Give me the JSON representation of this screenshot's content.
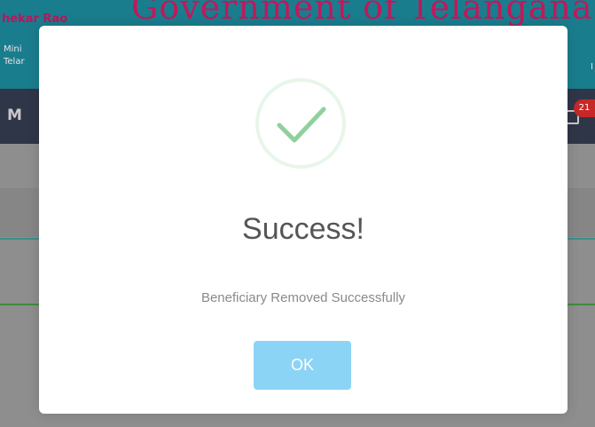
{
  "background": {
    "header_left_name": "hekar Rao",
    "header_left_line1": "Mini",
    "header_left_line2": "Telar",
    "header_title": "Government of Telangana",
    "header_right_mark": "I",
    "nav_left_letter": "M",
    "notification_badge": "21"
  },
  "modal": {
    "icon": "checkmark-circle-icon",
    "title": "Success!",
    "message": "Beneficiary Removed Successfully",
    "ok_label": "OK"
  },
  "colors": {
    "header": "#1a7d8e",
    "nav": "#2f3647",
    "title_pink": "#c2185b",
    "success_green": "#8fd19e",
    "success_ring": "#e8f6ea",
    "ok_button": "#8cd4f5",
    "overlay": "#8e8e8e"
  }
}
